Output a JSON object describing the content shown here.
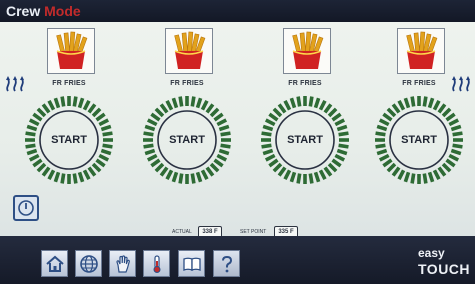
{
  "header": {
    "title_word1": "Crew",
    "title_word2": "Mode"
  },
  "vats": [
    {
      "product": "FR FRIES",
      "button": "START"
    },
    {
      "product": "FR FRIES",
      "button": "START"
    },
    {
      "product": "FR FRIES",
      "button": "START"
    },
    {
      "product": "FR FRIES",
      "button": "START"
    }
  ],
  "temperature": {
    "actual_label": "ACTUAL",
    "actual_value": "338 F",
    "setpoint_label": "SET POINT",
    "setpoint_value": "335 F"
  },
  "nav": [
    "home-icon",
    "globe-icon",
    "hand-icon",
    "thermometer-icon",
    "book-icon",
    "help-icon"
  ],
  "brand": {
    "line1": "easy",
    "line2": "TOUCH"
  },
  "colors": {
    "dial_ticks": "#2e6b35",
    "accent_blue": "#2e4f85",
    "mode_red": "#c22b2b"
  }
}
